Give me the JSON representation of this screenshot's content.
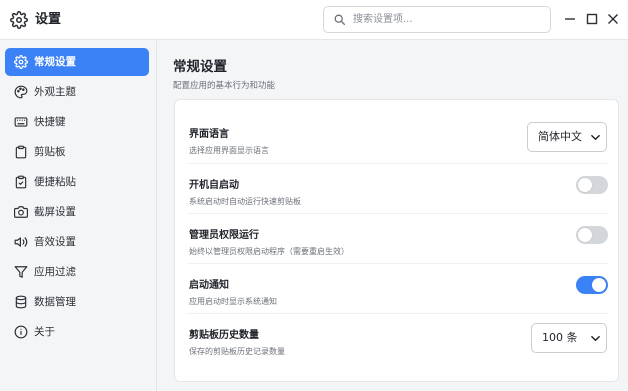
{
  "app": {
    "title": "设置",
    "icon": "gear-icon"
  },
  "search": {
    "placeholder": "搜索设置项...",
    "value": "",
    "icon": "search-icon"
  },
  "window_controls": [
    "minimize-icon",
    "maximize-icon",
    "close-icon"
  ],
  "sidebar": {
    "items": [
      {
        "label": "常规设置",
        "icon": "gear-icon",
        "active": true
      },
      {
        "label": "外观主题",
        "icon": "palette-icon",
        "active": false
      },
      {
        "label": "快捷键",
        "icon": "keyboard-icon",
        "active": false
      },
      {
        "label": "剪贴板",
        "icon": "clipboard-icon",
        "active": false
      },
      {
        "label": "便捷粘贴",
        "icon": "clipboard-check-icon",
        "active": false
      },
      {
        "label": "截屏设置",
        "icon": "camera-icon",
        "active": false
      },
      {
        "label": "音效设置",
        "icon": "speaker-icon",
        "active": false
      },
      {
        "label": "应用过滤",
        "icon": "filter-icon",
        "active": false
      },
      {
        "label": "数据管理",
        "icon": "database-icon",
        "active": false
      },
      {
        "label": "关于",
        "icon": "info-icon",
        "active": false
      }
    ]
  },
  "main": {
    "title": "常规设置",
    "subtitle": "配置应用的基本行为和功能",
    "settings": [
      {
        "title": "界面语言",
        "description": "选择应用界面显示语言",
        "control": "select",
        "value": "简体中文"
      },
      {
        "title": "开机自启动",
        "description": "系统启动时自动运行快速剪贴板",
        "control": "toggle",
        "on": false
      },
      {
        "title": "管理员权限运行",
        "description": "始终以管理员权限启动程序（需要重启生效）",
        "control": "toggle",
        "on": false
      },
      {
        "title": "启动通知",
        "description": "应用启动时显示系统通知",
        "control": "toggle",
        "on": true
      },
      {
        "title": "剪贴板历史数量",
        "description": "保存的剪贴板历史记录数量",
        "control": "select",
        "value": "100 条"
      }
    ]
  },
  "colors": {
    "accent": "#3b82f6",
    "toggle_off": "#d3d6da",
    "sidebar_bg": "#f4f5f7",
    "card_bg": "#ffffff"
  }
}
